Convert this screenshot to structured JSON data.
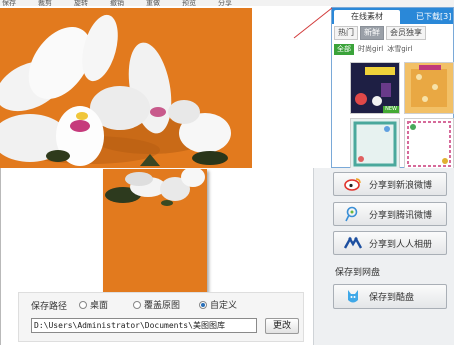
{
  "toolbar": {
    "items": [
      "保存",
      "裁剪",
      "旋转",
      "撤销",
      "重做",
      "预览",
      "分享"
    ]
  },
  "materials": {
    "tab_online": "在线素材",
    "tab_downloaded": "已下载[3]",
    "filters": [
      "热门",
      "新鲜",
      "会员独享"
    ],
    "active_filter": 1,
    "categories": [
      "全部",
      "时尚girl",
      "冰雪girl"
    ],
    "active_category": 0,
    "new_badge": "NEW"
  },
  "share": {
    "sina": "分享到新浪微博",
    "tencent": "分享到腾讯微博",
    "renren": "分享到人人相册",
    "netdisk_label": "保存到网盘",
    "netdisk_button": "保存到酷盘"
  },
  "save": {
    "label": "保存路径",
    "options": [
      "桌面",
      "覆盖原图",
      "自定义"
    ],
    "selected": 2,
    "path": "D:\\Users\\Administrator\\Documents\\美图图库",
    "change_button": "更改"
  },
  "colors": {
    "accent": "#2a88d8",
    "photo_bg": "#e27a1e",
    "green": "#3aa33a"
  }
}
